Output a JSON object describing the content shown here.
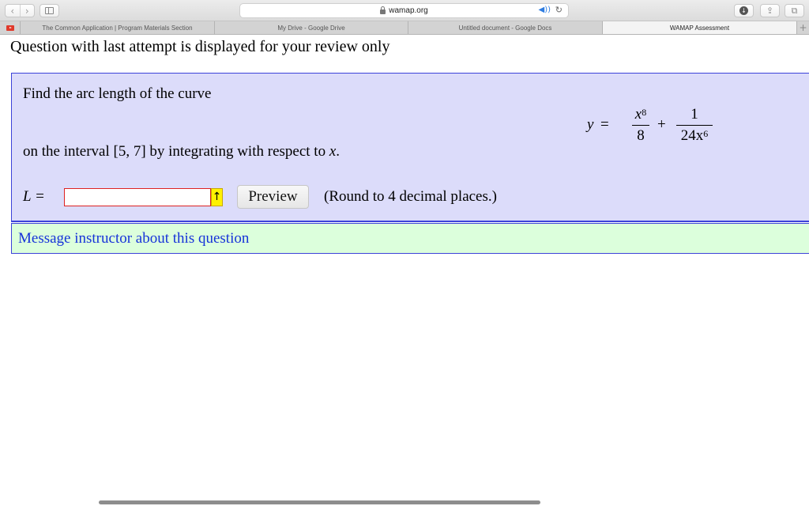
{
  "browser": {
    "url": "wamap.org",
    "tabs": [
      {
        "label": "The Common Application | Program Materials Section",
        "active": false
      },
      {
        "label": "My Drive - Google Drive",
        "active": false
      },
      {
        "label": "Untitled document - Google Docs",
        "active": false
      },
      {
        "label": "WAMAP Assessment",
        "active": true
      }
    ],
    "new_tab_label": "+",
    "icons": [
      "back-icon",
      "forward-icon",
      "sidebar-icon",
      "lock-icon",
      "audio-icon",
      "reload-icon",
      "download-icon",
      "share-icon",
      "tabs-overview-icon",
      "pinned-tab-icon"
    ]
  },
  "page": {
    "review_note": "Question with last attempt is displayed for your review only",
    "question": {
      "intro": "Find the arc length of the curve",
      "formula": {
        "lhs": "y",
        "eq": "=",
        "frac1_num_base": "x",
        "frac1_num_exp": "8",
        "frac1_den": "8",
        "plus": "+",
        "frac2_num": "1",
        "frac2_den_base": "24x",
        "frac2_den_exp": "6"
      },
      "interval_prefix": "on the interval ",
      "interval": "[5, 7]",
      "interval_suffix_before_var": " by integrating with respect to ",
      "variable": "x",
      "interval_suffix_end": ".",
      "answer_label": "L =",
      "answer_value": "",
      "arrow_tag": "↑",
      "preview_label": "Preview",
      "round_note": "(Round to 4 decimal places.)"
    },
    "message_link": "Message instructor about this question"
  },
  "colors": {
    "question_bg": "#dcdcfa",
    "question_border": "#3c43d9",
    "message_bg": "#dcffdc",
    "link": "#1632d9",
    "input_border": "#dd2222",
    "arrow_tag_bg": "#fff200"
  }
}
